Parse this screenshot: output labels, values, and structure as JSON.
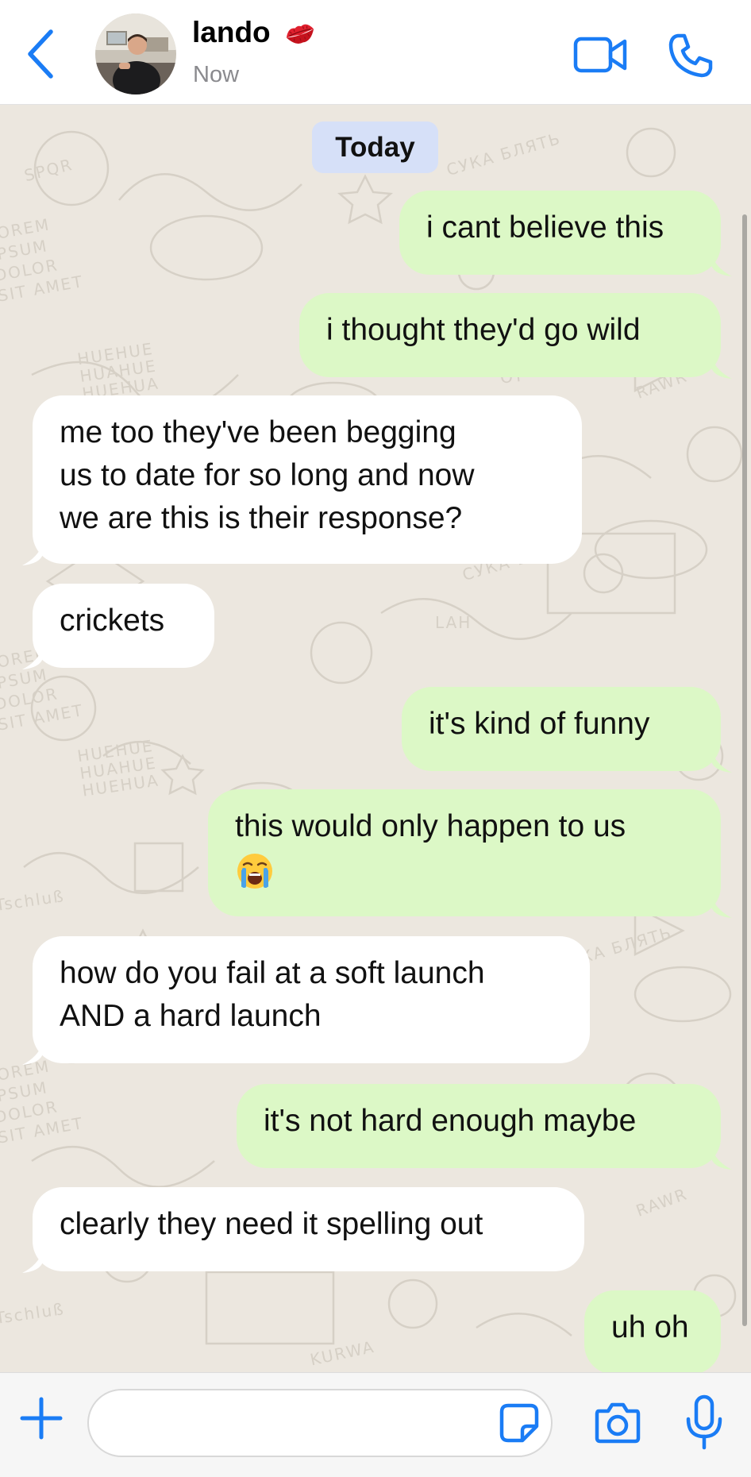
{
  "header": {
    "contact_name": "lando",
    "contact_emoji": "kiss-mark-emoji",
    "status": "Now",
    "accent_color": "#1a7cf5"
  },
  "chat": {
    "date_label": "Today",
    "wallpaper_words": [
      "СУКА БЛЯТЬ",
      "LOREM IPSUM DOLOR SIT AMET",
      "HUEHUE HUAHUE HUEHUA",
      "RAWR",
      "SPQR",
      "Tschluß",
      "KURWA",
      "LAH",
      "OY"
    ],
    "messages": [
      {
        "direction": "out",
        "lines": [
          "i cant believe this"
        ]
      },
      {
        "direction": "out",
        "lines": [
          "i thought they'd go wild"
        ]
      },
      {
        "direction": "in",
        "lines": [
          "me too they've been begging",
          "us to date for so long and now",
          "we are this is their response?"
        ]
      },
      {
        "direction": "in",
        "lines": [
          "crickets"
        ]
      },
      {
        "direction": "out",
        "lines": [
          "it's kind of funny"
        ]
      },
      {
        "direction": "out",
        "lines": [
          "this would only happen to us"
        ],
        "emoji": "loudly-crying-emoji"
      },
      {
        "direction": "in",
        "lines": [
          "how do you fail at a soft launch",
          "AND a hard launch"
        ]
      },
      {
        "direction": "out",
        "lines": [
          "it's not hard enough maybe"
        ]
      },
      {
        "direction": "in",
        "lines": [
          "clearly they need it spelling out"
        ]
      },
      {
        "direction": "out",
        "lines": [
          "uh oh"
        ]
      }
    ]
  },
  "input": {
    "value": "",
    "placeholder": ""
  },
  "colors": {
    "outgoing_bubble": "#dcf8c6",
    "incoming_bubble": "#ffffff",
    "chat_background": "#ece7df",
    "date_pill": "#d6e0f8"
  }
}
